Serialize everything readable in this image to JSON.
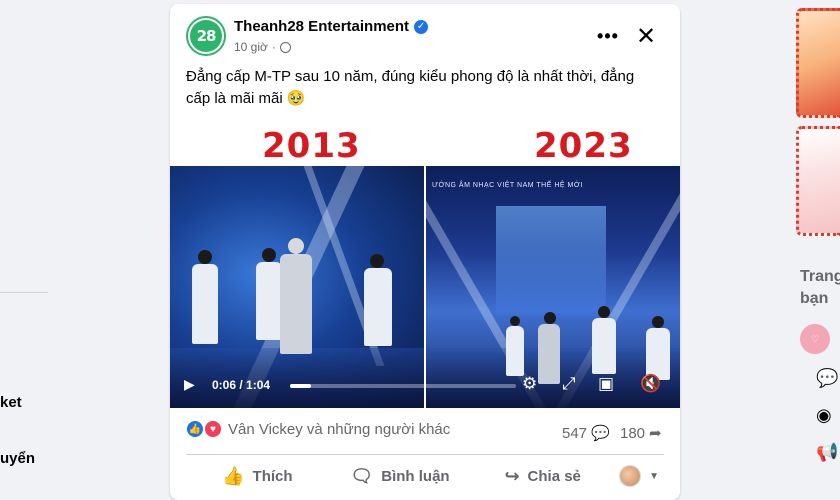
{
  "left_sidebar": {
    "item_1": "ket",
    "item_2": "uyển"
  },
  "post": {
    "author": "Theanh28 Entertainment",
    "avatar_text": "28",
    "time": "10 giờ",
    "caption": "Đẳng cấp M-TP sau 10 năm, đúng kiểu phong độ là nhất thời, đẳng cấp là mãi mãi 🥹",
    "media": {
      "year_left": "2013",
      "year_right": "2023",
      "stage_text": "ƯỚNG ÂM NHẠC VIỆT NAM THẾ HỆ MỚI",
      "video_time": "0:06 / 1:04",
      "progress": 0.094
    },
    "reactions_text": "Vân Vickey và những người khác",
    "comments_count": "547",
    "shares_count": "180",
    "actions": {
      "like": "Thích",
      "comment": "Bình luận",
      "share": "Chia sẻ"
    }
  },
  "right_column": {
    "heading_line_1": "Trang",
    "heading_line_2": "bạn"
  },
  "colors": {
    "brand_blue": "#1b74e4",
    "year_red": "#d71920",
    "avatar_green": "#2db36a"
  }
}
